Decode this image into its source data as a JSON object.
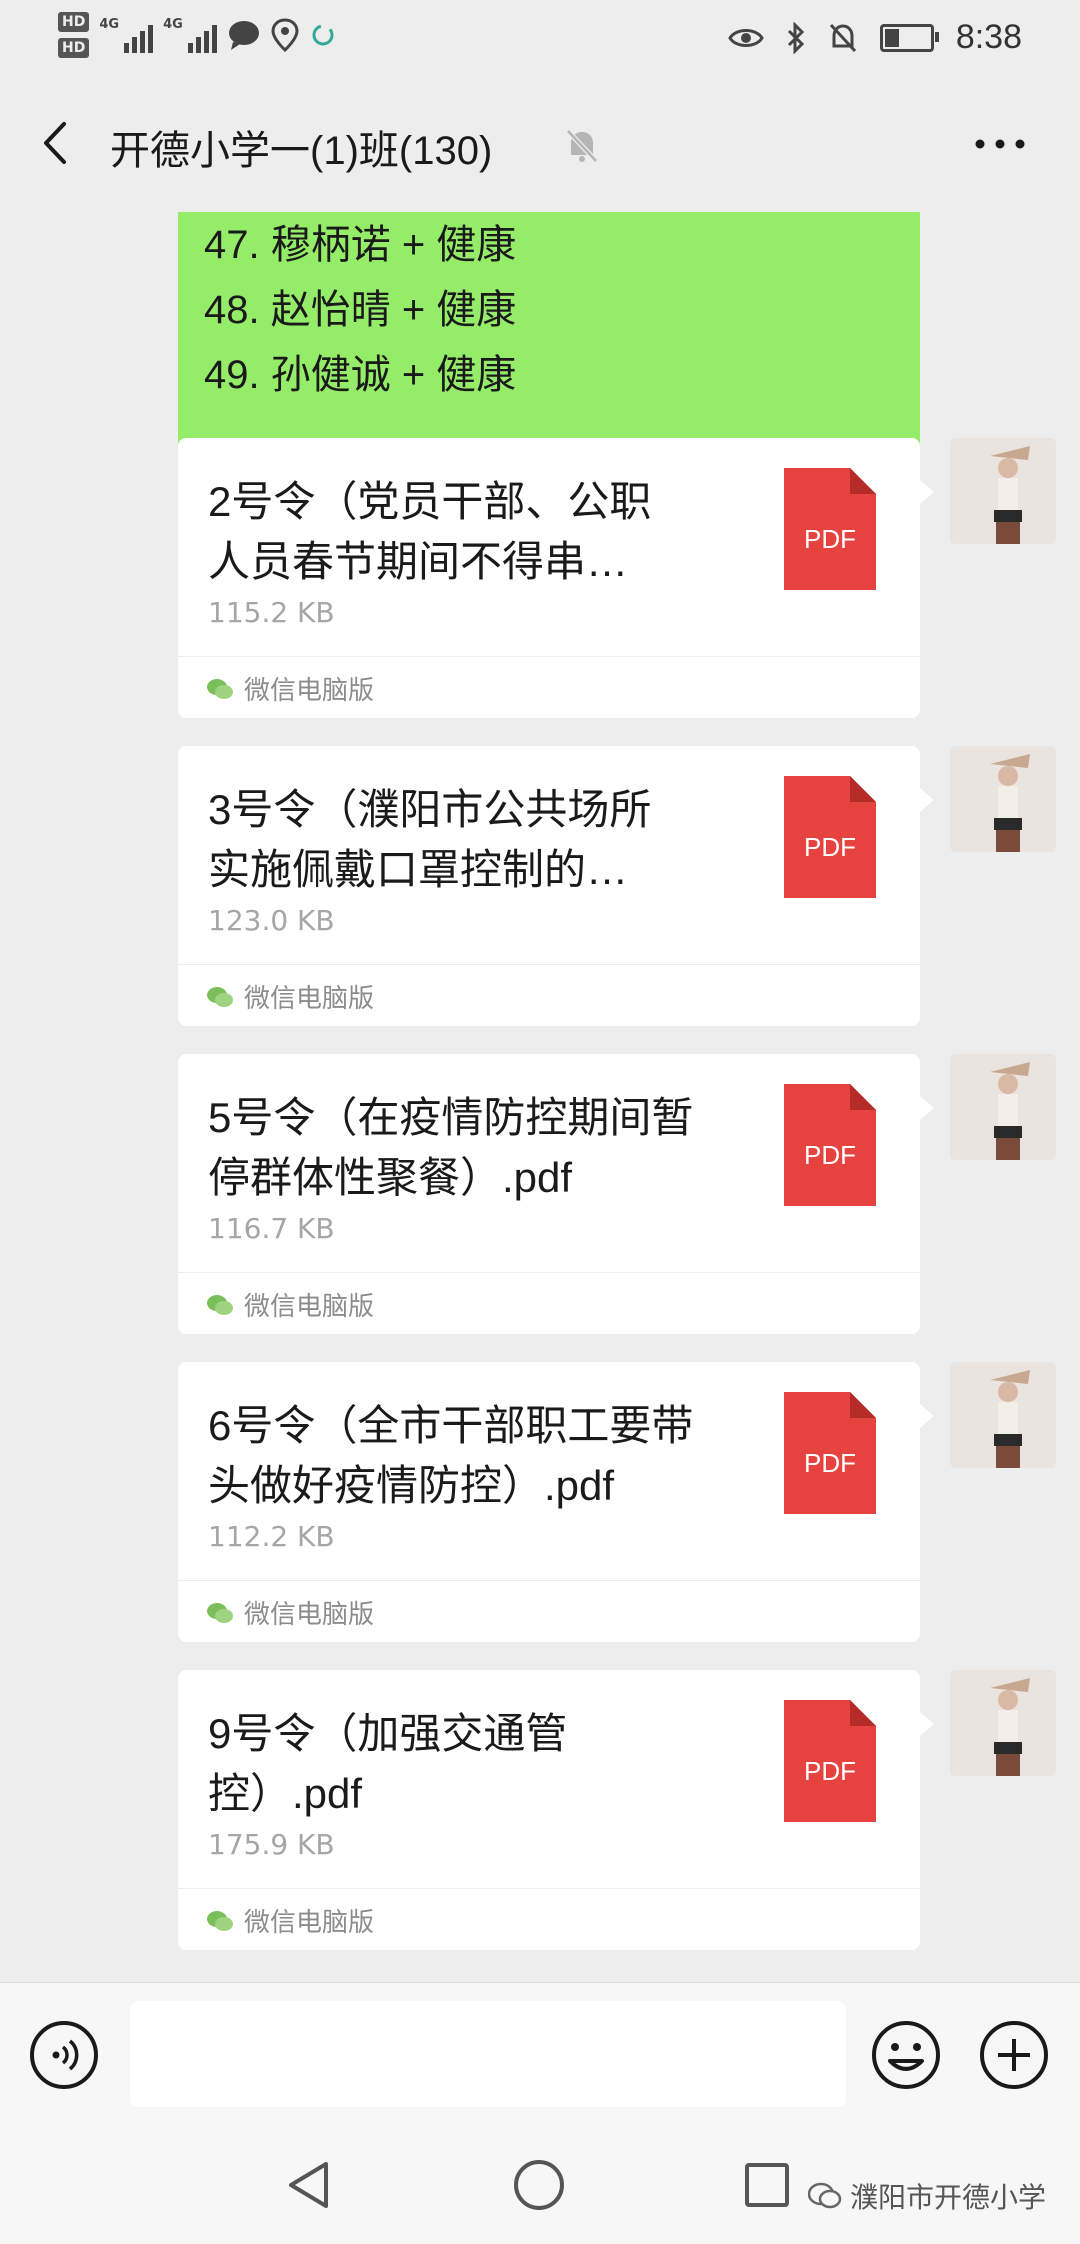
{
  "status_bar": {
    "hd1": "HD",
    "hd2": "HD",
    "network1": "4G",
    "network2": "4G",
    "time": "8:38"
  },
  "header": {
    "title": "开德小学一(1)班(130)"
  },
  "green_message": {
    "lines": [
      "47. 穆柄诺 + 健康",
      "48. 赵怡晴 + 健康",
      "49. 孙健诚 + 健康"
    ]
  },
  "file_messages": [
    {
      "name": "2号令（党员干部、公职\n人员春节期间不得串…",
      "size": "115.2 KB",
      "source": "微信电脑版",
      "icon_label": "PDF"
    },
    {
      "name": "3号令（濮阳市公共场所\n实施佩戴口罩控制的…",
      "size": "123.0 KB",
      "source": "微信电脑版",
      "icon_label": "PDF"
    },
    {
      "name": "5号令（在疫情防控期间暂\n停群体性聚餐）.pdf",
      "size": "116.7 KB",
      "source": "微信电脑版",
      "icon_label": "PDF"
    },
    {
      "name": "6号令（全市干部职工要带\n头做好疫情防控）.pdf",
      "size": "112.2 KB",
      "source": "微信电脑版",
      "icon_label": "PDF"
    },
    {
      "name": "9号令（加强交通管\n控）.pdf",
      "size": "175.9 KB",
      "source": "微信电脑版",
      "icon_label": "PDF"
    }
  ],
  "input_bar": {
    "placeholder": ""
  },
  "watermark": {
    "text": "濮阳市开德小学"
  },
  "colors": {
    "sent_bubble": "#95ec69",
    "pdf_red": "#e64340",
    "background": "#ededed"
  }
}
